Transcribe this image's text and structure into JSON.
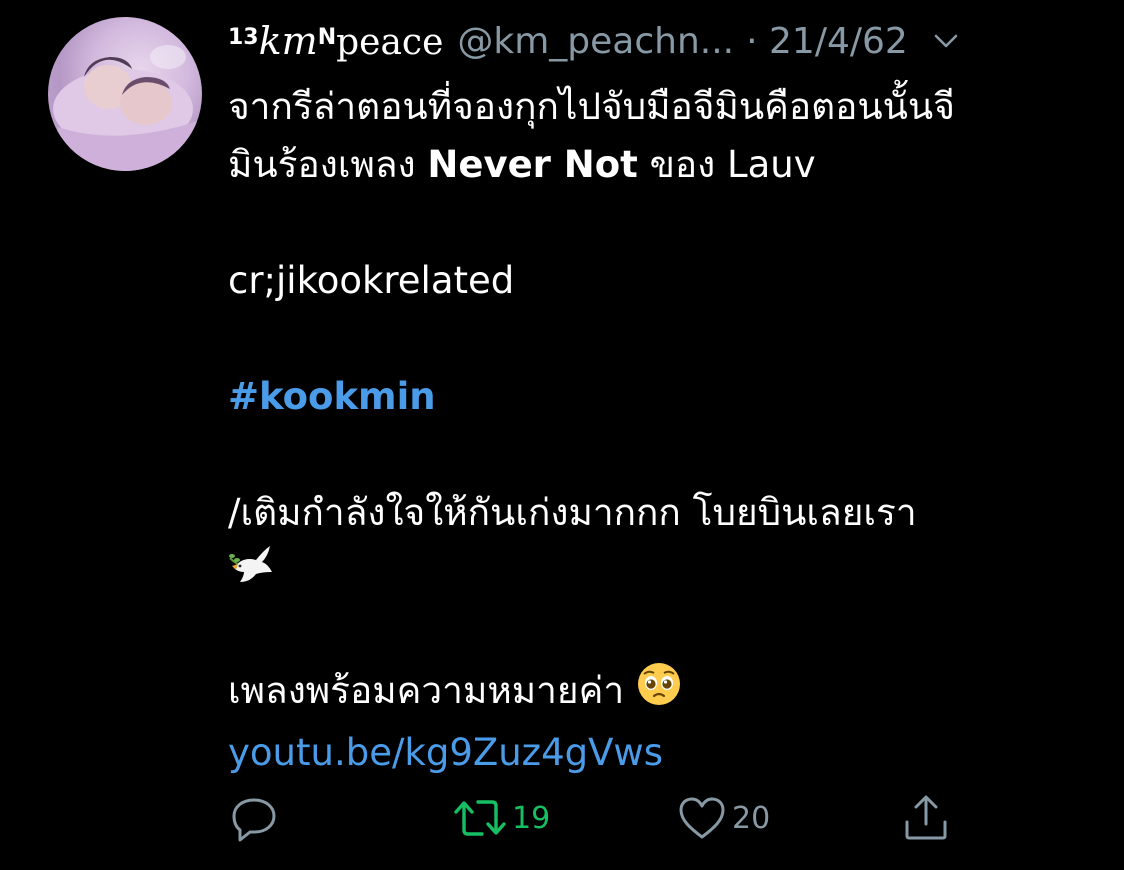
{
  "tweet": {
    "author": {
      "name_prefix": "13",
      "name_script": "km",
      "name_sup": "N",
      "name_rest": "peace",
      "handle": "@km_peachn...",
      "date": "· 21/4/62"
    },
    "lines": {
      "l1": "จากรีล่าตอนที่จองกุกไปจับมือจีมินคือตอนนั้นจี",
      "l2_pre": "มินร้องเพลง ",
      "l2_bold": "Never Not",
      "l2_post": " ของ Lauv",
      "credit": "cr;jikookrelated",
      "hashtag": "#kookmin",
      "note": "/เติมกำลังใจให้กันเก่งมากกก โบยบินเลยเรา",
      "song_line": "เพลงพร้อมความหมายค่า",
      "link": "youtu.be/kg9Zuz4gVws"
    },
    "emojis": {
      "dove": "dove-emoji",
      "pleading": "pleading-face-emoji"
    },
    "actions": {
      "reply_icon": "reply-icon",
      "retweet_icon": "retweet-icon",
      "retweet_count": "19",
      "like_icon": "heart-icon",
      "like_count": "20",
      "share_icon": "share-icon"
    }
  },
  "colors": {
    "background": "#000000",
    "text": "#ffffff",
    "muted": "#8899a6",
    "link": "#4a9be8",
    "retweet": "#17bf63"
  }
}
